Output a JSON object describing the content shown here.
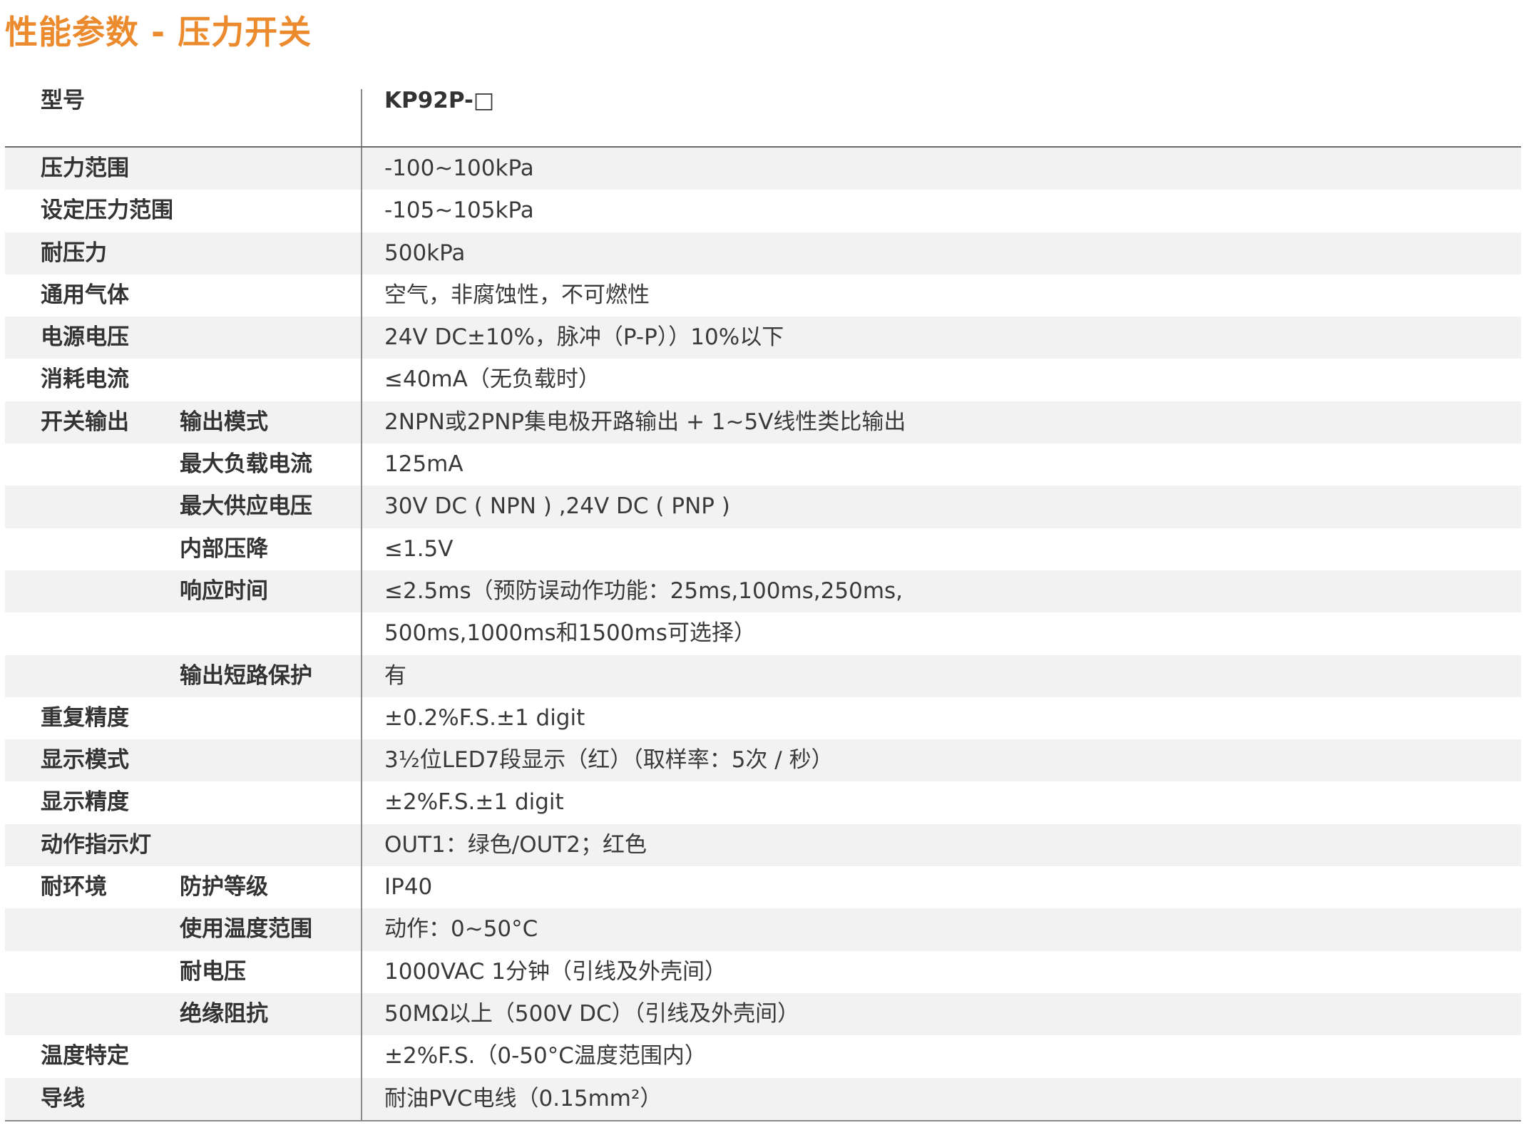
{
  "title": "性能参数 - 压力开关",
  "header": {
    "label": "型号",
    "value": "KP92P-□"
  },
  "rows": [
    {
      "c1": "压力范围",
      "c2": "",
      "c3": "-100~100kPa"
    },
    {
      "c1": "设定压力范围",
      "c2": "",
      "c3": "-105~105kPa"
    },
    {
      "c1": "耐压力",
      "c2": "",
      "c3": "500kPa"
    },
    {
      "c1": "通用气体",
      "c2": "",
      "c3": "空气，非腐蚀性，不可燃性"
    },
    {
      "c1": "电源电压",
      "c2": "",
      "c3": "24V DC±10%，脉冲（P-P））10%以下"
    },
    {
      "c1": "消耗电流",
      "c2": "",
      "c3": "≤40mA（无负载时）"
    },
    {
      "c1": "开关输出",
      "c2": "输出模式",
      "c3": "2NPN或2PNP集电极开路输出 + 1~5V线性类比输出"
    },
    {
      "c1": "",
      "c2": "最大负载电流",
      "c3": "125mA"
    },
    {
      "c1": "",
      "c2": "最大供应电压",
      "c3": "30V DC ( NPN ) ,24V DC ( PNP )"
    },
    {
      "c1": "",
      "c2": "内部压降",
      "c3": "≤1.5V"
    },
    {
      "c1": "",
      "c2": "响应时间",
      "c3": "≤2.5ms（预防误动作功能：25ms,100ms,250ms,"
    },
    {
      "c1": "",
      "c2": "",
      "c3": "500ms,1000ms和1500ms可选择）"
    },
    {
      "c1": "",
      "c2": "输出短路保护",
      "c3": "有"
    },
    {
      "c1": "重复精度",
      "c2": "",
      "c3": "±0.2%F.S.±1 digit"
    },
    {
      "c1": "显示模式",
      "c2": "",
      "c3": "3½位LED7段显示（红）（取样率：5次 / 秒）"
    },
    {
      "c1": "显示精度",
      "c2": "",
      "c3": "±2%F.S.±1 digit"
    },
    {
      "c1": "动作指示灯",
      "c2": "",
      "c3": "OUT1：绿色/OUT2；红色"
    },
    {
      "c1": "耐环境",
      "c2": "防护等级",
      "c3": "IP40"
    },
    {
      "c1": "",
      "c2": "使用温度范围",
      "c3": "动作：0~50°C"
    },
    {
      "c1": "",
      "c2": "耐电压",
      "c3": "1000VAC 1分钟（引线及外壳间）"
    },
    {
      "c1": "",
      "c2": "绝缘阻抗",
      "c3": "50MΩ以上（500V DC）（引线及外壳间）"
    },
    {
      "c1": "温度特定",
      "c2": "",
      "c3": "±2%F.S.（0-50°C温度范围内）"
    },
    {
      "c1": "导线",
      "c2": "",
      "c3": "耐油PVC电线（0.15mm²）"
    }
  ]
}
